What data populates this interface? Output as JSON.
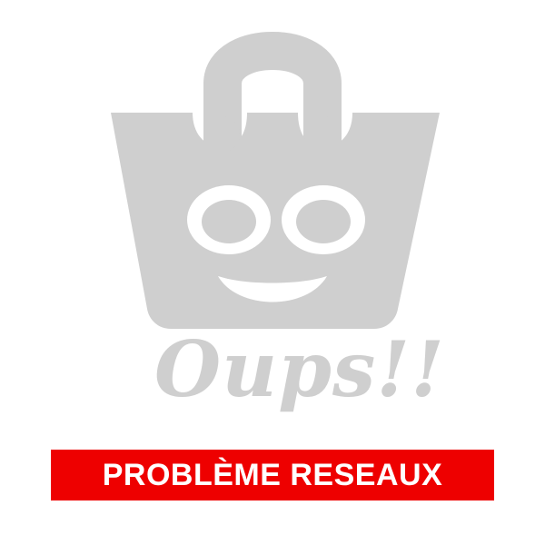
{
  "illustration": {
    "icon": "shopping-basket-face-icon",
    "color": "#cfcfcf"
  },
  "headline": {
    "text": "Oups!!"
  },
  "error_banner": {
    "text": "PROBLÈME RESEAUX",
    "background": "#ee0000",
    "text_color": "#ffffff"
  }
}
